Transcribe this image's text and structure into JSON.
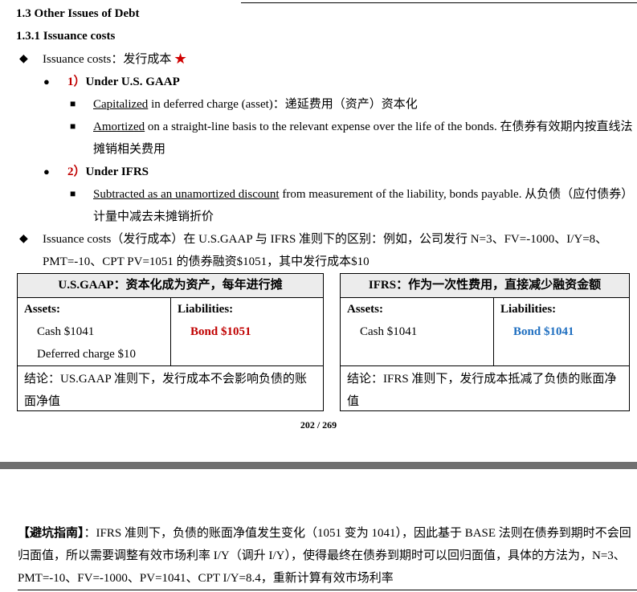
{
  "section": {
    "title": "1.3 Other Issues of Debt",
    "subtitle": "1.3.1 Issuance costs"
  },
  "bullets": {
    "issuance_label": "Issuance costs：发行成本",
    "star": "★",
    "gaap_num": "1）",
    "gaap_title": "Under U.S. GAAP",
    "gaap_item1_u": "Capitalized",
    "gaap_item1_rest": " in deferred charge (asset)：递延费用（资产）资本化",
    "gaap_item2_u": "Amortized",
    "gaap_item2_rest": " on a straight-line basis to the relevant expense over the life of the bonds. 在债券有效期内按直线法摊销相关费用",
    "ifrs_num": "2）",
    "ifrs_title": "Under IFRS",
    "ifrs_item1_u": "Subtracted as an unamortized discount",
    "ifrs_item1_rest": " from measurement of the liability, bonds payable. 从负债（应付债券）计量中减去未摊销折价",
    "diff_text": "Issuance costs（发行成本）在 U.S.GAAP 与 IFRS 准则下的区别：例如，公司发行 N=3、FV=-1000、I/Y=8、PMT=-10、CPT PV=1051 的债券融资$1051，其中发行成本$10"
  },
  "table_gaap": {
    "header": "U.S.GAAP：资本化成为资产，每年进行摊",
    "assets_label": "Assets:",
    "asset1": "Cash $1041",
    "asset2": "Deferred charge $10",
    "liab_label": "Liabilities:",
    "liab1": "Bond $1051",
    "conclusion": "结论：US.GAAP 准则下，发行成本不会影响负债的账面净值"
  },
  "table_ifrs": {
    "header": "IFRS：作为一次性费用，直接减少融资金额",
    "assets_label": "Assets:",
    "asset1": "Cash $1041",
    "liab_label": "Liabilities:",
    "liab1": "Bond $1041",
    "conclusion": "结论：IFRS 准则下，发行成本抵减了负债的账面净值"
  },
  "page_number": "202 / 269",
  "tip": {
    "label": "【避坑指南】",
    "text": "：IFRS 准则下，负债的账面净值发生变化（1051 变为 1041），因此基于 BASE 法则在债券到期时不会回归面值，所以需要调整有效市场利率 I/Y（调升 I/Y），使得最终在债券到期时可以回归面值，具体的方法为，N=3、PMT=-10、FV=-1000、PV=1041、CPT I/Y=8.4，重新计算有效市场利率"
  },
  "colors": {
    "red": "#c00000",
    "blue": "#1f6fc0",
    "header_bg": "#ececec"
  }
}
